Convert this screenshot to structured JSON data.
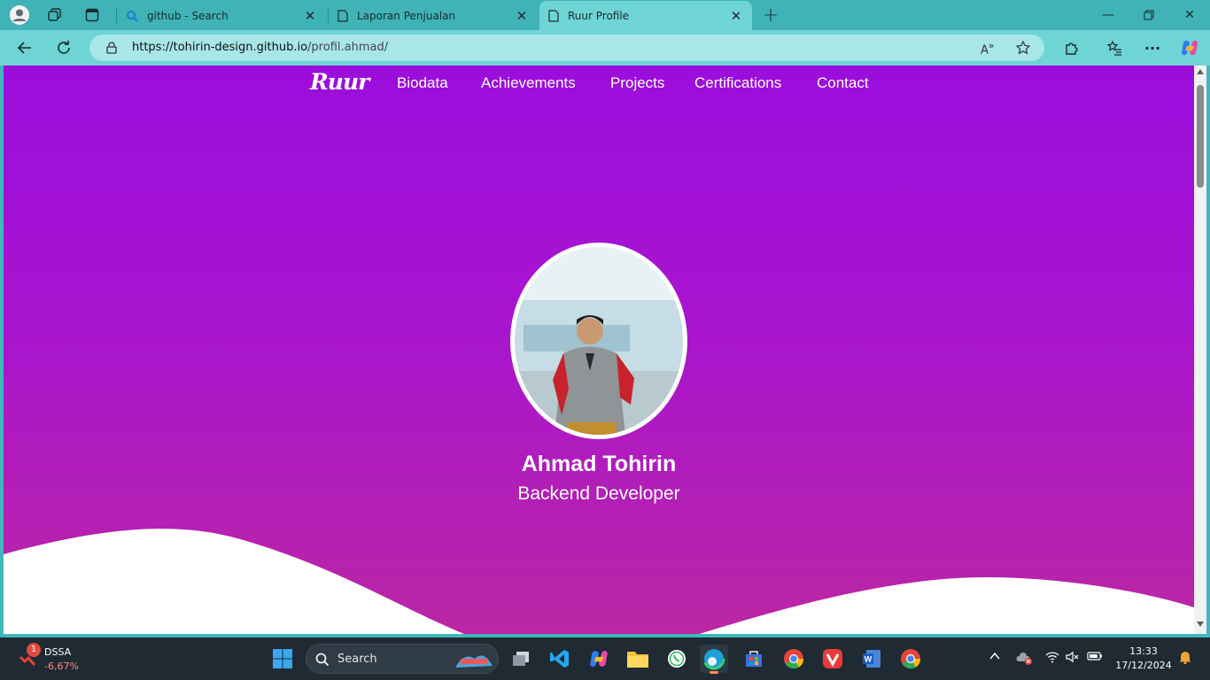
{
  "browser": {
    "tabs": [
      {
        "label": "github - Search",
        "icon": "search-icon"
      },
      {
        "label": "Laporan Penjualan",
        "icon": "page-icon"
      },
      {
        "label": "Ruur Profile",
        "icon": "page-icon",
        "active": true
      }
    ],
    "url_domain": "https://tohirin-design.github.io",
    "url_path": "/profil.ahmad/"
  },
  "page": {
    "logo": "Ruur",
    "nav": [
      "Biodata",
      "Achievements",
      "Projects",
      "Certifications",
      "Contact"
    ],
    "name": "Ahmad Tohirin",
    "role": "Backend Developer",
    "colors": {
      "gradient_top": "#9b0ddc",
      "gradient_bottom": "#bb26a4",
      "wave": "#ffffff"
    }
  },
  "taskbar": {
    "stock_badge": "1",
    "stock_symbol": "DSSA",
    "stock_change": "-6,67%",
    "search_placeholder": "Search",
    "time": "13:33",
    "date": "17/12/2024"
  }
}
